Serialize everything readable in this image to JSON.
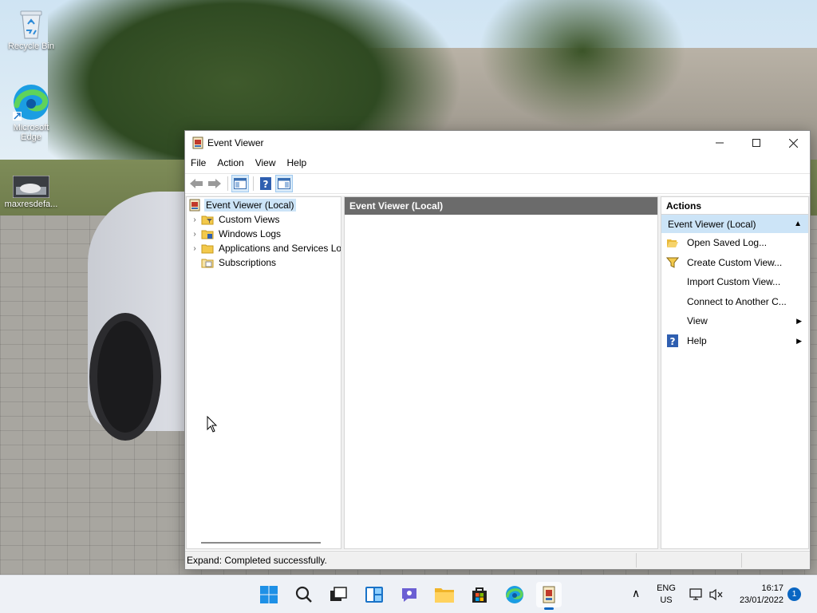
{
  "desktop": {
    "icons": [
      {
        "label": "Recycle Bin"
      },
      {
        "label": "Microsoft Edge"
      },
      {
        "label": "maxresdefa..."
      }
    ]
  },
  "window": {
    "title": "Event Viewer",
    "controls": {
      "minimize": "—",
      "maximize": "☐",
      "close": "✕"
    },
    "menu": [
      "File",
      "Action",
      "View",
      "Help"
    ],
    "tree": [
      {
        "label": "Event Viewer (Local)",
        "selected": true,
        "expandable": false
      },
      {
        "label": "Custom Views",
        "expandable": true
      },
      {
        "label": "Windows Logs",
        "expandable": true
      },
      {
        "label": "Applications and Services Lo",
        "expandable": true
      },
      {
        "label": "Subscriptions",
        "expandable": false
      }
    ],
    "center_header": "Event Viewer (Local)",
    "actions": {
      "header": "Actions",
      "group": "Event Viewer (Local)",
      "items": [
        {
          "label": "Open Saved Log...",
          "icon": "folder-open-icon"
        },
        {
          "label": "Create Custom View...",
          "icon": "filter-icon"
        },
        {
          "label": "Import Custom View...",
          "icon": ""
        },
        {
          "label": "Connect to Another C...",
          "icon": ""
        },
        {
          "label": "View",
          "icon": "",
          "submenu": true
        },
        {
          "label": "Help",
          "icon": "help-icon",
          "submenu": true
        }
      ]
    },
    "status": "Expand:  Completed successfully."
  },
  "taskbar": {
    "language": {
      "line1": "ENG",
      "line2": "US"
    },
    "clock": {
      "time": "16:17",
      "date": "23/01/2022"
    },
    "notification_count": "1"
  },
  "colors": {
    "selection": "#cce4f7",
    "header_gray": "#6b6b6b",
    "accent": "#0a66c2"
  }
}
